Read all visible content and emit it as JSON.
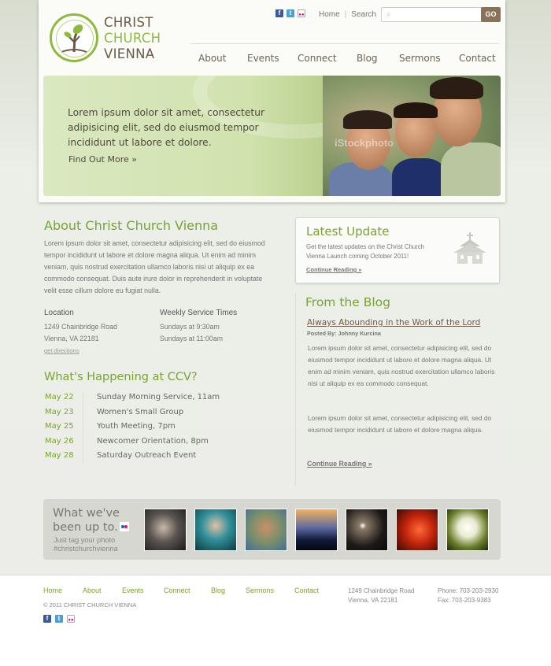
{
  "logo": {
    "line1": "CHRIST",
    "line2": "CHURCH",
    "line3": "VIENNA"
  },
  "utility": {
    "social": [
      "f",
      "t",
      "fl"
    ],
    "home": "Home",
    "search_link": "Search",
    "search_placeholder": "",
    "go": "GO"
  },
  "nav": [
    "About",
    "Events",
    "Connect",
    "Blog",
    "Sermons",
    "Contact"
  ],
  "hero": {
    "text": "Lorem ipsum dolor sit amet, consectetur adipisicing elit, sed do eiusmod tempor incididunt ut labore et dolore.",
    "link": "Find Out More »",
    "watermark": "iStockphoto"
  },
  "about": {
    "title": "About Christ Church Vienna",
    "body": "Lorem ipsum dolor sit amet, consectetur adipisicing elit, sed do eiusmod tempor incididunt ut labore et dolore magna aliqua. Ut enim ad minim veniam, quis nostrud exercitation ullamco laboris nisi ut aliquip ex ea commodo consequat. Duis aute irure dolor in reprehenderit in voluptate velit esse cillum dolore eu fugiat nulla.",
    "location_heading": "Location",
    "address1": "1249 Chainbridge Road",
    "address2": "Vienna, VA 22181",
    "directions": "get directions",
    "service_heading": "Weekly Service Times",
    "service1": "Sundays at 9:30am",
    "service2": "Sundays at 11:00am"
  },
  "happening": {
    "title": "What's Happening at CCV?",
    "events": [
      {
        "date": "May 22",
        "title": "Sunday Morning Service, 11am"
      },
      {
        "date": "May 23",
        "title": "Women's Small Group"
      },
      {
        "date": "May 25",
        "title": "Youth Meeting, 7pm"
      },
      {
        "date": "May 26",
        "title": "Newcomer Orientation, 8pm"
      },
      {
        "date": "May 28",
        "title": "Saturday Outreach Event"
      }
    ]
  },
  "update": {
    "title": "Latest Update",
    "body": "Get the latest updates on the Christ Church Vienna Launch coming October 2011!",
    "link": "Continue Reading »"
  },
  "blog": {
    "title": "From the Blog",
    "post_title": "Always Abounding in the Work of  the Lord",
    "posted_by": "Posted By: Johnny Kurcina",
    "p1": "Lorem ipsum dolor sit amet, consectetur adipisicing elit, sed do eiusmod tempor incididunt ut labore et dolore magna aliqua. Ut enim ad minim veniam, quis nostrud exercitation ullamco laboris nisi ut aliquip ex ea commodo consequat.",
    "p2": "Lorem ipsum dolor sit amet, consectetur adipisicing elit, sed do eiusmod tempor incididunt ut labore et dolore magna aliqua.",
    "more": "Continue Reading »"
  },
  "flickr": {
    "heading1": "What we've",
    "heading2": "been up to.",
    "sub1": "Just tag your photo",
    "sub2": "#christchurchvienna"
  },
  "footer": {
    "nav": [
      "Home",
      "About",
      "Events",
      "Connect",
      "Blog",
      "Sermons",
      "Contact"
    ],
    "copyright": "© 2011 CHRIST CHURCH VIENNA",
    "address1": "1249 Chainbridge Road",
    "address2": "Vienna, VA 22181",
    "phone": "Phone:  703-203-2930",
    "fax": "Fax: 703-203-9383"
  },
  "colors": {
    "accent": "#7aa233",
    "brown": "#8a7256",
    "text": "#777777"
  }
}
